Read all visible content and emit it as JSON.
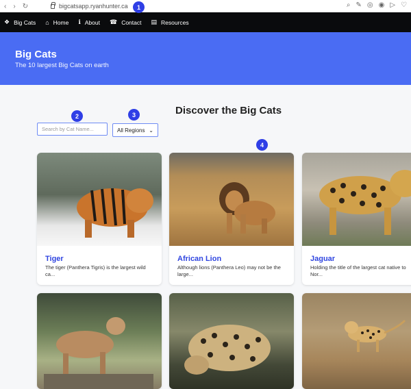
{
  "browser": {
    "url": "bigcatsapp.ryanhunter.ca",
    "back_icon": "‹",
    "forward_icon": "›",
    "reload_icon": "↻",
    "tools": [
      "⌕",
      "✎",
      "◎",
      "◉",
      "▷",
      "♡"
    ]
  },
  "topnav": {
    "brand": "Big Cats",
    "items": [
      {
        "label": "Home",
        "icon": "home-icon"
      },
      {
        "label": "About",
        "icon": "info-icon"
      },
      {
        "label": "Contact",
        "icon": "phone-icon"
      },
      {
        "label": "Resources",
        "icon": "book-icon"
      }
    ]
  },
  "hero": {
    "title": "Big Cats",
    "subtitle": "The 10 largest Big Cats on earth"
  },
  "section": {
    "title": "Discover the Big Cats"
  },
  "controls": {
    "search_placeholder": "Search by Cat Name...",
    "region_selected": "All Regions",
    "chevron": "⌄"
  },
  "markers": [
    "1",
    "2",
    "3",
    "4"
  ],
  "cards": [
    {
      "name": "Tiger",
      "desc": "The tiger (Panthera Tigris) is the largest wild ca..."
    },
    {
      "name": "African Lion",
      "desc": "Although lions (Panthera Leo) may not be the large..."
    },
    {
      "name": "Jaguar",
      "desc": "Holding the title of the largest cat native to Nor..."
    },
    {
      "name": "",
      "desc": ""
    },
    {
      "name": "",
      "desc": ""
    },
    {
      "name": "",
      "desc": ""
    }
  ],
  "colors": {
    "accent": "#4a6cf3",
    "nav_bg": "#0a0b0d",
    "card_title": "#2f45e0",
    "marker": "#2f3fe6"
  }
}
